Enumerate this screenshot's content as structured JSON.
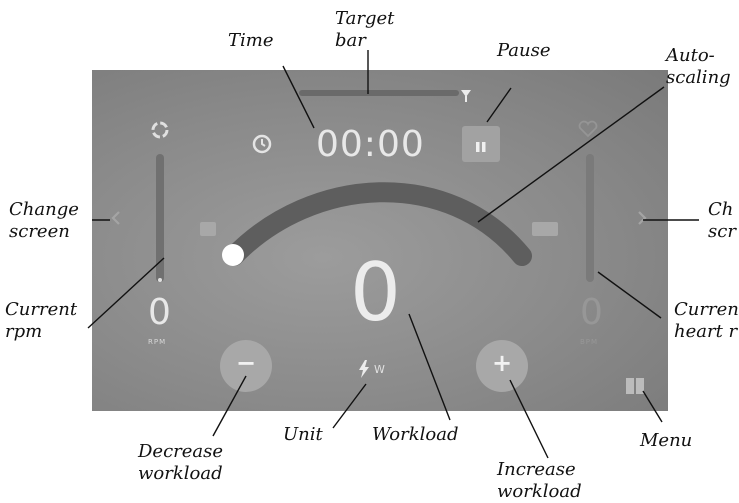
{
  "callouts": {
    "time": "Time",
    "target_bar": "Target\nbar",
    "pause": "Pause",
    "auto_scaling": "Auto-\nscaling",
    "change_screen_left": "Change\nscreen",
    "change_screen_right": "Ch\nscr",
    "current_rpm": "Current\nrpm",
    "current_heart_rate": "Curren\nheart r",
    "decrease_workload": "Decrease\nworkload",
    "unit": "Unit",
    "workload": "Workload",
    "increase_workload": "Increase\nworkload",
    "menu": "Menu"
  },
  "display": {
    "time": "00:00",
    "rpm_value": "0",
    "rpm_unit": "RPM",
    "heart_rate_value": "0",
    "heart_rate_unit": "BPM",
    "workload_value": "0",
    "workload_unit": "W",
    "decrease_symbol": "−",
    "increase_symbol": "+"
  },
  "colors": {
    "screen_bg": "#8a8a8a",
    "arc": "#5e5e5e",
    "button_bg": "#b0b0b0",
    "text_light": "#e6e6e6"
  },
  "icons": [
    "clock-icon",
    "pause-icon",
    "rpm-icon",
    "heart-icon",
    "chevron-left-icon",
    "chevron-right-icon",
    "flag-icon",
    "bolt-icon",
    "menu-icon"
  ]
}
